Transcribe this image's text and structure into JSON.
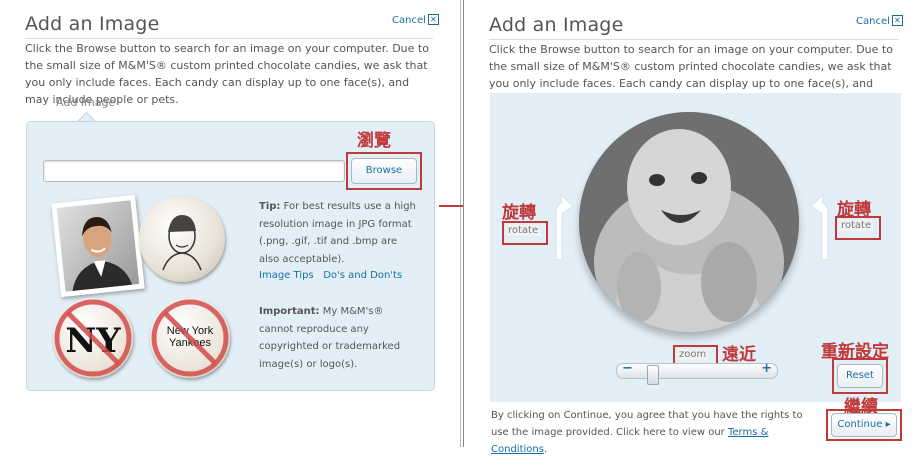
{
  "left": {
    "title": "Add an Image",
    "cancel": "Cancel",
    "intro": "Click the Browse button to search for an image on your computer. Due to the small size of M&M'S® custom printed chocolate candies, we ask that you only include faces. Each candy can display up to one face(s), and may include people or pets.",
    "tab": "Add Image",
    "browse_label": "Browse",
    "browse_annotation": "瀏覽",
    "tip_label": "Tip:",
    "tip_text": "For best results use a high resolution image in JPG format (.png, .gif, .tif and .bmp are also acceptable).",
    "image_tips_link": "Image Tips",
    "dos_donts_link": "Do's and Don'ts",
    "important_label": "Important:",
    "important_text": "My M&M's® cannot reproduce any copyrighted or trademarked image(s) or logo(s).",
    "candy_ny": "New York Yankees",
    "candy_logo": "NY"
  },
  "right": {
    "title": "Add an Image",
    "cancel": "Cancel",
    "intro": "Click the Browse button to search for an image on your computer. Due to the small size of M&M'S® custom printed chocolate candies, we ask that you only include faces. Each candy can display up to one face(s), and may include people or pets.",
    "rotate_left": "rotate",
    "rotate_right": "rotate",
    "rotate_annotation_left": "旋轉",
    "rotate_annotation_right": "旋轉",
    "zoom_label": "zoom",
    "zoom_annotation": "遠近",
    "zoom_minus": "−",
    "zoom_plus": "+",
    "zoom_level": 0.08,
    "reset_label": "Reset",
    "reset_annotation": "重新設定",
    "continue_annotation": "繼續",
    "continue_label": "Continue",
    "agreement_text": "By clicking on Continue, you agree that you have the rights to use the image provided.  Click here to view our",
    "terms_link": "Terms & Conditions",
    "terms_end": "."
  },
  "colors": {
    "accent": "#1a6fa0",
    "annotation": "#c0393b",
    "panel_bg": "#e3eff7"
  }
}
